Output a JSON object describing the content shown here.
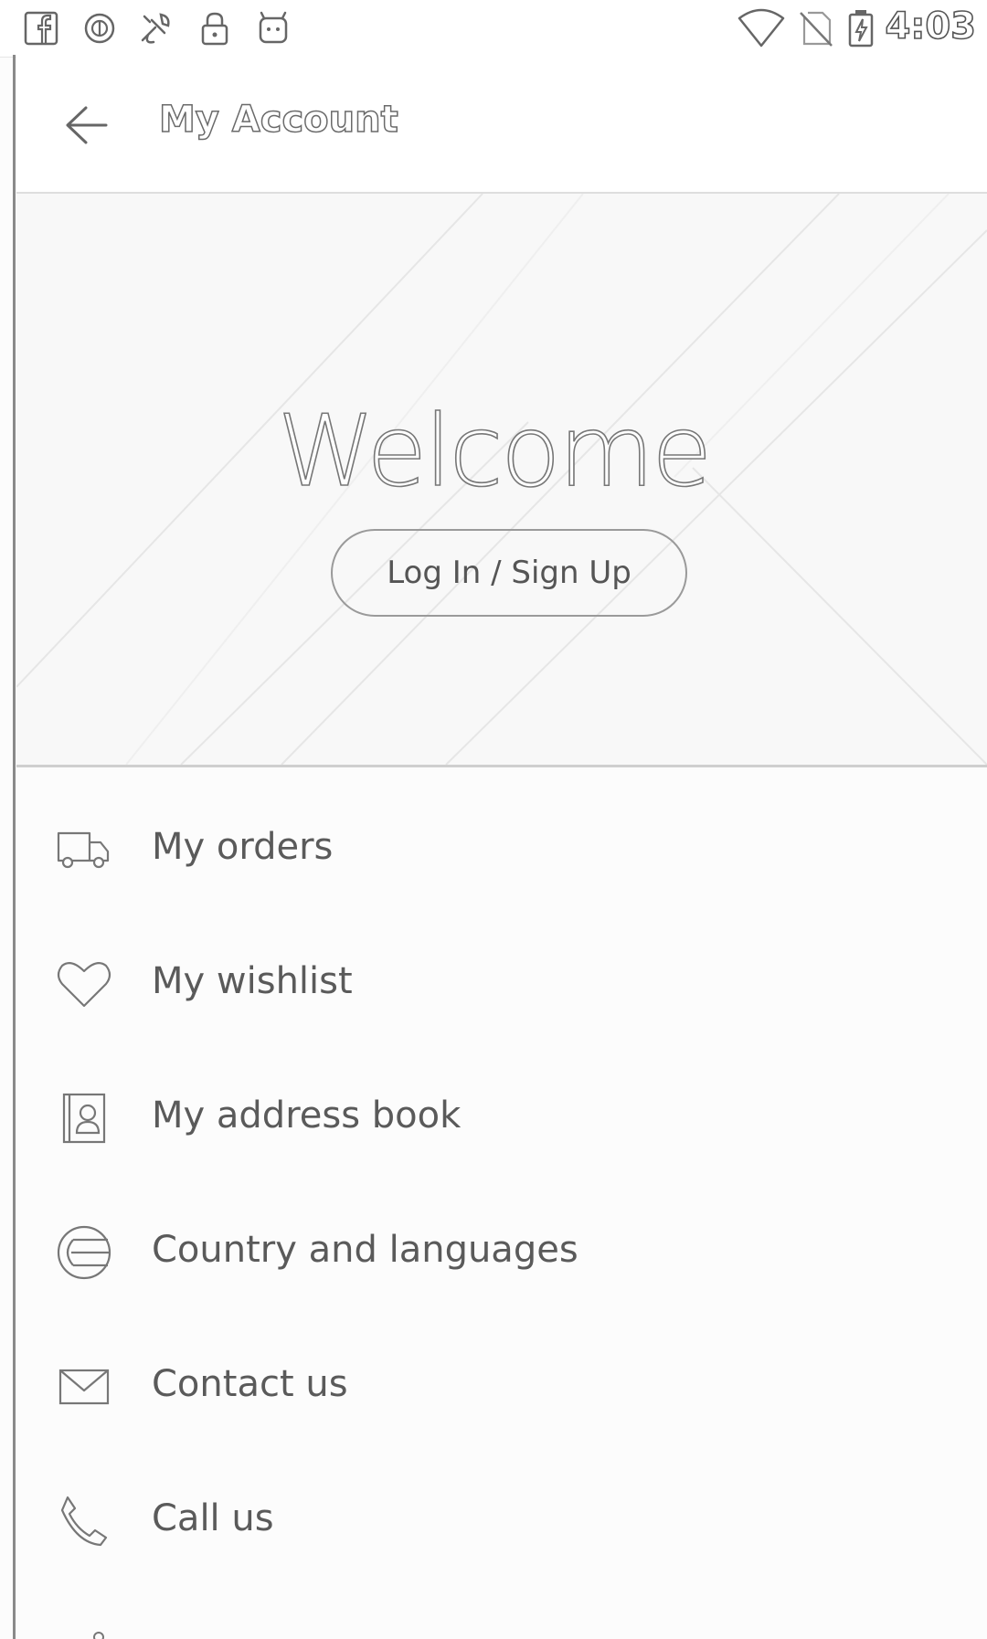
{
  "status_bar": {
    "time": "4:03",
    "left_icons": [
      "facebook-icon",
      "circle-icon",
      "tools-icon",
      "lock-icon",
      "android-icon"
    ],
    "right_icons": [
      "wifi-icon",
      "no-sim-icon",
      "battery-charging-icon"
    ]
  },
  "app_bar": {
    "back_icon": "arrow-left-icon",
    "title": "My Account"
  },
  "hero": {
    "welcome": "Welcome",
    "login_button": "Log In / Sign Up"
  },
  "menu": {
    "items": [
      {
        "label": "My orders",
        "icon": "truck-icon"
      },
      {
        "label": "My wishlist",
        "icon": "heart-icon"
      },
      {
        "label": "My address book",
        "icon": "address-book-icon"
      },
      {
        "label": "Country and languages",
        "icon": "globe-icon"
      },
      {
        "label": "Contact us",
        "icon": "envelope-icon"
      },
      {
        "label": "Call us",
        "icon": "phone-icon"
      }
    ]
  },
  "colors": {
    "text": "#5a5a5a",
    "outline": "#9a9a9a",
    "background": "#fcfcfc"
  }
}
